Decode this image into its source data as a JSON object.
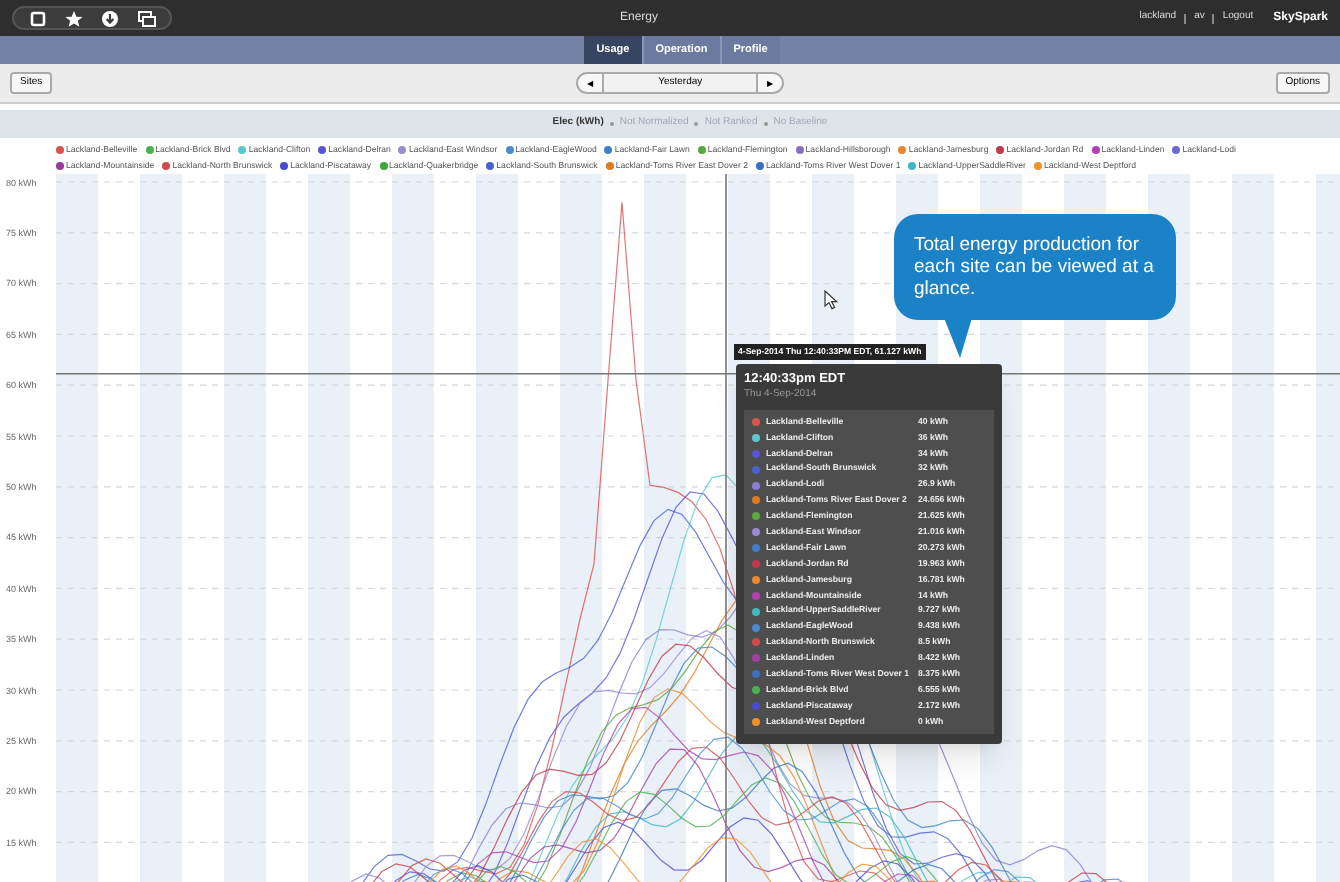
{
  "top_bar": {
    "title": "Energy",
    "user": "lackland",
    "user_alt": "av",
    "logout": "Logout",
    "brand": "SkySpark"
  },
  "tabs": [
    {
      "label": "Usage",
      "selected": true
    },
    {
      "label": "Operation",
      "selected": false
    },
    {
      "label": "Profile",
      "selected": false
    }
  ],
  "toolbar": {
    "sites": "Sites",
    "prev": "◀",
    "period": "Yesterday",
    "next": "▶",
    "options": "Options"
  },
  "chart_title": {
    "measure": "Elec (kWh)",
    "settings": [
      "Not Normalized",
      "Not Ranked",
      "No Baseline"
    ]
  },
  "legend": [
    {
      "label": "Lackland-Belleville",
      "color": "#d9534f"
    },
    {
      "label": "Lackland-Brick Blvd",
      "color": "#4caf50"
    },
    {
      "label": "Lackland-Clifton",
      "color": "#5bc8d0"
    },
    {
      "label": "Lackland-Delran",
      "color": "#5656d6"
    },
    {
      "label": "Lackland-East Windsor",
      "color": "#9a8ad0"
    },
    {
      "label": "Lackland-EagleWood",
      "color": "#4a8ad0"
    },
    {
      "label": "Lackland-Fair Lawn",
      "color": "#3f7fc8"
    },
    {
      "label": "Lackland-Flemington",
      "color": "#5aa83c"
    },
    {
      "label": "Lackland-Hillsborough",
      "color": "#8a6fc0"
    },
    {
      "label": "Lackland-Jamesburg",
      "color": "#e8872f"
    },
    {
      "label": "Lackland-Jordan Rd",
      "color": "#c0394a"
    },
    {
      "label": "Lackland-Linden",
      "color": "#b040b0"
    },
    {
      "label": "Lackland-Lodi",
      "color": "#6a6ad0"
    },
    {
      "label": "Lackland-Mountainside",
      "color": "#9a3a9a"
    },
    {
      "label": "Lackland-North Brunswick",
      "color": "#d04a4a"
    },
    {
      "label": "Lackland-Piscataway",
      "color": "#4a4ad0"
    },
    {
      "label": "Lackland-Quakerbridge",
      "color": "#3aa83a"
    },
    {
      "label": "Lackland-South Brunswick",
      "color": "#4a60d0"
    },
    {
      "label": "Lackland-Toms River East Dover 2",
      "color": "#e07a20"
    },
    {
      "label": "Lackland-Toms River West Dover 1",
      "color": "#3a70c0"
    },
    {
      "label": "Lackland-UpperSaddleRiver",
      "color": "#40b8c0"
    },
    {
      "label": "Lackland-West Deptford",
      "color": "#f0902a"
    }
  ],
  "y_axis_labels": [
    "80 kWh",
    "75 kWh",
    "70 kWh",
    "65 kWh",
    "60 kWh",
    "55 kWh",
    "50 kWh",
    "45 kWh",
    "40 kWh",
    "35 kWh",
    "30 kWh",
    "25 kWh",
    "20 kWh",
    "15 kWh"
  ],
  "cursor_label": "4-Sep-2014 Thu 12:40:33PM EDT, 61.127 kWh",
  "tooltip": {
    "time": "12:40:33pm EDT",
    "date": "Thu 4-Sep-2014",
    "rows": [
      {
        "site": "Lackland-Belleville",
        "value": "40 kWh",
        "color": "#d9534f"
      },
      {
        "site": "Lackland-Clifton",
        "value": "36 kWh",
        "color": "#5bc8d0"
      },
      {
        "site": "Lackland-Delran",
        "value": "34 kWh",
        "color": "#5656d6"
      },
      {
        "site": "Lackland-South Brunswick",
        "value": "32 kWh",
        "color": "#4a60d0"
      },
      {
        "site": "Lackland-Lodi",
        "value": "26.9 kWh",
        "color": "#8a7fd0"
      },
      {
        "site": "Lackland-Toms River East Dover 2",
        "value": "24.656 kWh",
        "color": "#e07a20"
      },
      {
        "site": "Lackland-Flemington",
        "value": "21.625 kWh",
        "color": "#5aa83c"
      },
      {
        "site": "Lackland-East Windsor",
        "value": "21.016 kWh",
        "color": "#9a8ad0"
      },
      {
        "site": "Lackland-Fair Lawn",
        "value": "20.273 kWh",
        "color": "#3f7fc8"
      },
      {
        "site": "Lackland-Jordan Rd",
        "value": "19.963 kWh",
        "color": "#c0394a"
      },
      {
        "site": "Lackland-Jamesburg",
        "value": "16.781 kWh",
        "color": "#e8872f"
      },
      {
        "site": "Lackland-Mountainside",
        "value": "14 kWh",
        "color": "#b040b0"
      },
      {
        "site": "Lackland-UpperSaddleRiver",
        "value": "9.727 kWh",
        "color": "#40b8c0"
      },
      {
        "site": "Lackland-EagleWood",
        "value": "9.438 kWh",
        "color": "#4a8ad0"
      },
      {
        "site": "Lackland-North Brunswick",
        "value": "8.5 kWh",
        "color": "#d04a4a"
      },
      {
        "site": "Lackland-Linden",
        "value": "8.422 kWh",
        "color": "#a040a0"
      },
      {
        "site": "Lackland-Toms River West Dover 1",
        "value": "8.375 kWh",
        "color": "#3a70c0"
      },
      {
        "site": "Lackland-Brick Blvd",
        "value": "6.555 kWh",
        "color": "#4caf50"
      },
      {
        "site": "Lackland-Piscataway",
        "value": "2.172 kWh",
        "color": "#4a4ad0"
      },
      {
        "site": "Lackland-West Deptford",
        "value": "0 kWh",
        "color": "#f0902a"
      }
    ]
  },
  "callout": "Total energy production for each site can be viewed at a glance."
}
